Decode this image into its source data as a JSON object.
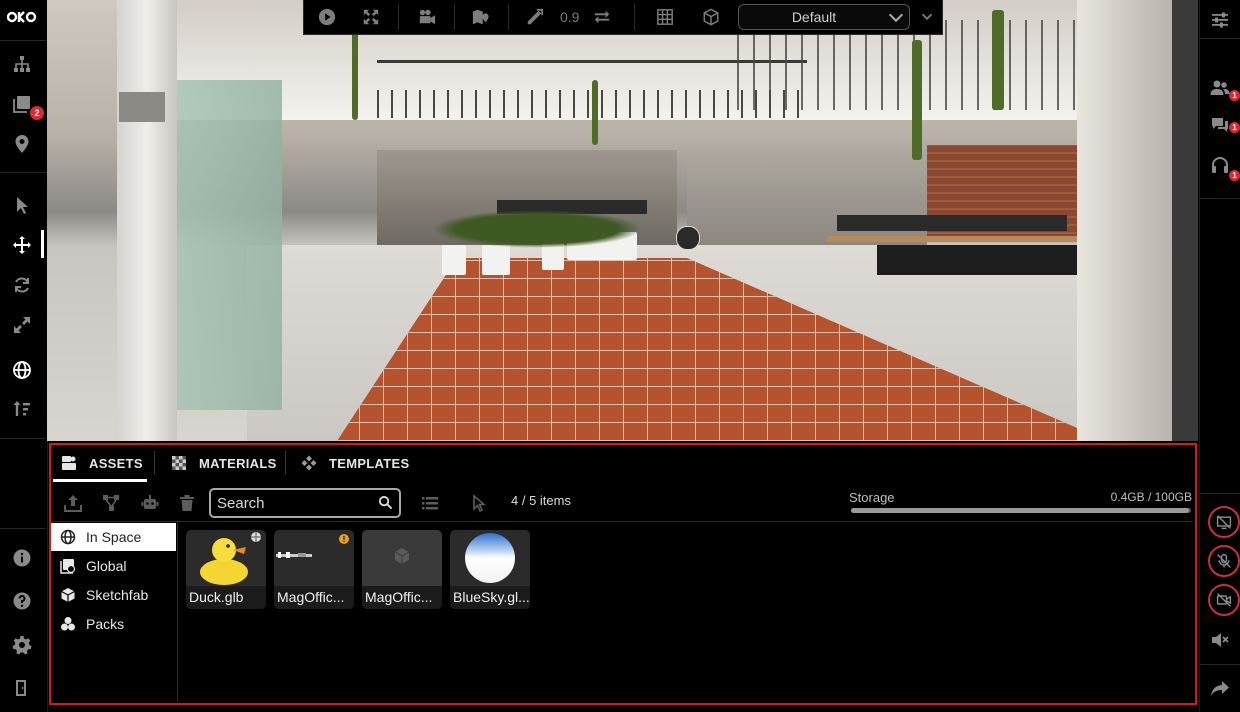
{
  "brand": {
    "logo_text": "OKO"
  },
  "left_rail": {
    "badge_count": "2"
  },
  "toolbar": {
    "snap_value": "0.9",
    "preset_selected": "Default"
  },
  "right_rail": {
    "users_badge": "1",
    "chat_badge": "1",
    "audio_badge": "1"
  },
  "panel": {
    "tabs": [
      {
        "label": "ASSETS",
        "icon": "assets-icon",
        "active": true
      },
      {
        "label": "MATERIALS",
        "icon": "checker-icon",
        "active": false
      },
      {
        "label": "TEMPLATES",
        "icon": "templates-icon",
        "active": false
      }
    ],
    "search": {
      "placeholder": "Search",
      "value": ""
    },
    "item_count": "4 / 5 items",
    "storage": {
      "label": "Storage",
      "value": "0.4GB / 100GB",
      "fraction": 0.004
    },
    "categories": [
      {
        "label": "In Space",
        "icon": "globe-icon",
        "active": true
      },
      {
        "label": "Global",
        "icon": "global-library-icon",
        "active": false
      },
      {
        "label": "Sketchfab",
        "icon": "sketchfab-icon",
        "active": false
      },
      {
        "label": "Packs",
        "icon": "packs-icon",
        "active": false
      }
    ],
    "assets": [
      {
        "name": "Duck.glb",
        "thumb": "duck"
      },
      {
        "name": "MagOffic...",
        "thumb": "office-strip",
        "warning": "!"
      },
      {
        "name": "MagOffic...",
        "thumb": "cube"
      },
      {
        "name": "BlueSky.gl...",
        "thumb": "sky-sphere"
      }
    ]
  },
  "colors": {
    "highlight_border": "#e01515",
    "badge": "#e0262f",
    "warning": "#e6a01e",
    "floor": "#b5532f"
  }
}
